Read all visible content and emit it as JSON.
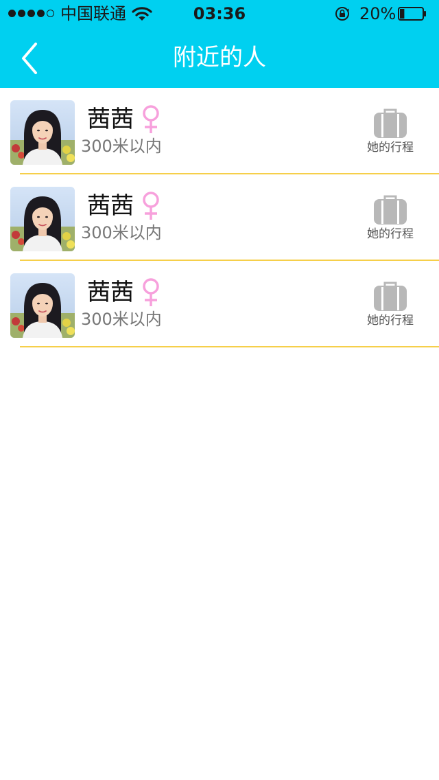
{
  "status_bar": {
    "carrier": "中国联通",
    "time": "03:36",
    "battery_percent": "20%",
    "signal_strength": 4,
    "battery_level": 0.2
  },
  "nav": {
    "title": "附近的人",
    "back_icon": "chevron-left-icon"
  },
  "colors": {
    "header_bg": "#00d0f0",
    "separator": "#f6cf4a",
    "female_symbol": "#f7a0dc",
    "suitcase": "#b8b8b8"
  },
  "people": [
    {
      "name": "茜茜",
      "gender_icon": "female-icon",
      "distance": "300米以内",
      "trip_label": "她的行程"
    },
    {
      "name": "茜茜",
      "gender_icon": "female-icon",
      "distance": "300米以内",
      "trip_label": "她的行程"
    },
    {
      "name": "茜茜",
      "gender_icon": "female-icon",
      "distance": "300米以内",
      "trip_label": "她的行程"
    }
  ]
}
